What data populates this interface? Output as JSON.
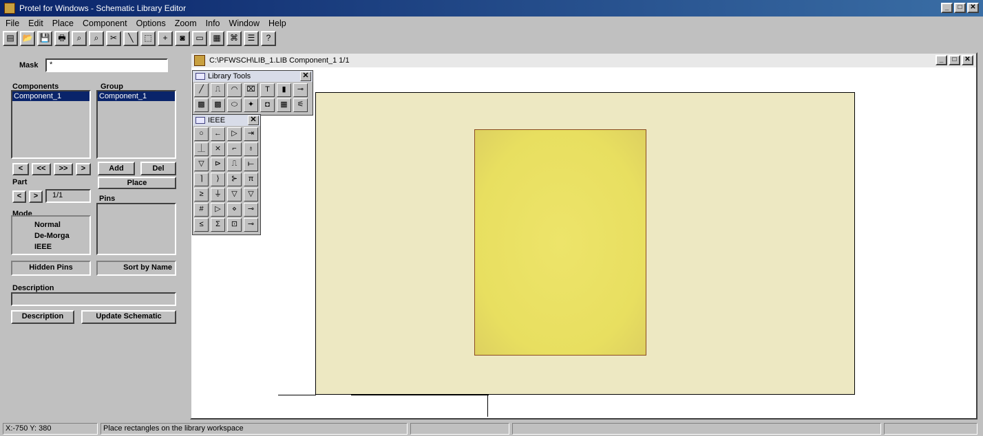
{
  "window": {
    "title": "Protel for Windows - Schematic Library Editor"
  },
  "menu": [
    "File",
    "Edit",
    "Place",
    "Component",
    "Options",
    "Zoom",
    "Info",
    "Window",
    "Help"
  ],
  "toolbar": [
    "▤",
    "📂",
    "💾",
    "🖶",
    "⌕",
    "⌕",
    "✂",
    "╲",
    "⬚",
    "+",
    "◙",
    "▭",
    "▦",
    "⌘",
    "☰",
    "?"
  ],
  "panel": {
    "mask_label": "Mask",
    "mask_value": "*",
    "components_label": "Components",
    "group_label": "Group",
    "components": [
      "Component_1"
    ],
    "group": [
      "Component_1"
    ],
    "nav": [
      "<",
      "<<",
      ">>",
      ">"
    ],
    "add": "Add",
    "del": "Del",
    "part_label": "Part",
    "place": "Place",
    "part_nav": [
      "<",
      ">"
    ],
    "part_value": "1/1",
    "pins_label": "Pins",
    "mode_label": "Mode",
    "modes": [
      "Normal",
      "De-Morga",
      "IEEE"
    ],
    "hidden_pins": "Hidden Pins",
    "sort_by_name": "Sort by Name",
    "description_label": "Description",
    "description_button": "Description",
    "update_button": "Update Schematic"
  },
  "document": {
    "title": "C:\\PFWSCH\\LIB_1.LIB  Component_1 1/1"
  },
  "library_tools": {
    "title": "Library Tools",
    "buttons": [
      "╱",
      "⎍",
      "◠",
      "⌧",
      "T",
      "▮",
      "⊸",
      "▩",
      "▩",
      "⬭",
      "✦",
      "◘",
      "▦",
      "⚟"
    ]
  },
  "ieee": {
    "title": "IEEE",
    "buttons": [
      "○",
      "←",
      "▷",
      "⇥",
      "⏊",
      "⨯",
      "⌐",
      "♁",
      "▽",
      "⊳",
      "⎍",
      "⟝",
      "⌉",
      "⟩",
      "⊱",
      "π",
      "≥",
      "⏚",
      "▽",
      "▽",
      "#",
      "▷",
      "⋄",
      "⊸",
      "≤",
      "Σ",
      "⊡",
      "⊸"
    ]
  },
  "status": {
    "coords": "X:-750 Y: 380",
    "message": "Place rectangles on the library workspace"
  }
}
